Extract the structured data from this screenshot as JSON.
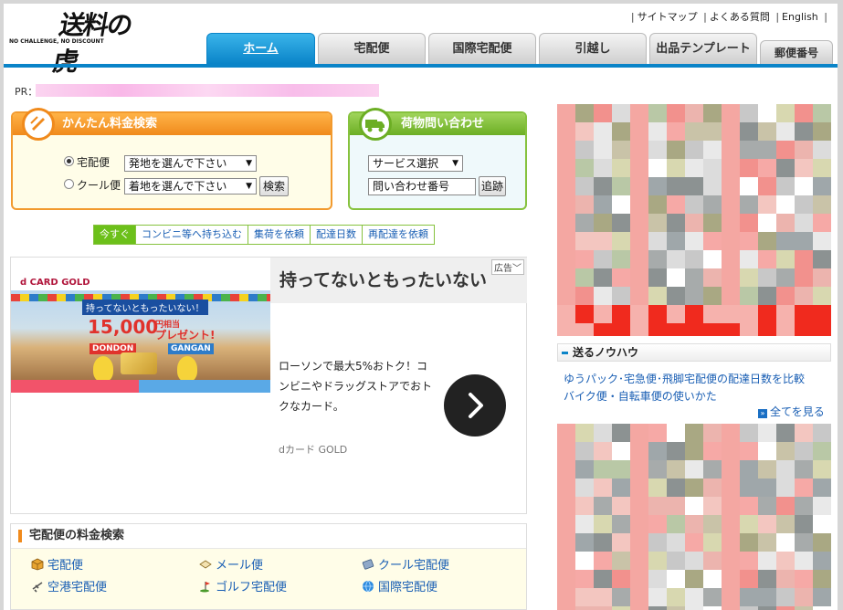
{
  "header": {
    "logo_text": "送料の虎",
    "logo_tagline": "NO CHALLENGE, NO DISCOUNT",
    "top_links": [
      "サイトマップ",
      "よくある質問",
      "English"
    ]
  },
  "tabs": [
    "ホーム",
    "宅配便",
    "国際宅配便",
    "引越し",
    "出品テンプレート",
    "郵便番号"
  ],
  "pr": {
    "label": "PR："
  },
  "rate_search": {
    "title": "かんたん料金検索",
    "option1": "宅配便",
    "option2": "クール便",
    "origin_select": "発地を選んで下さい",
    "dest_select": "着地を選んで下さい",
    "search_button": "検索"
  },
  "tracking": {
    "title": "荷物問い合わせ",
    "service_select": "サービス選択",
    "number_placeholder": "問い合わせ番号",
    "track_button": "追跡"
  },
  "subtabs": [
    "今すぐ",
    "コンビニ等へ持ち込む",
    "集荷を依頼",
    "配達日数",
    "再配達を依頼"
  ],
  "ad": {
    "badge": "広告",
    "headline": "持ってないともったいない",
    "body": "ローソンで最大5%おトク！コンビニやドラッグストアでおトクなカード。",
    "brand": "dカード GOLD",
    "img_brand": "d CARD GOLD",
    "img_banner": "持ってないともったいない！",
    "img_amount": "15,000",
    "img_unit": "円相当",
    "img_present": "プレゼント!",
    "img_left": "DONDON",
    "img_right": "GANGAN"
  },
  "price_search": {
    "title": "宅配便の料金検索",
    "items": [
      "宅配便",
      "メール便",
      "クール宅配便",
      "空港宅配便",
      "ゴルフ宅配便",
      "国際宅配便"
    ]
  },
  "knowhow": {
    "title": "送るノウハウ",
    "links": [
      "ゆうパック･宅急便･飛脚宅配便の配達日数を比較",
      "バイク便・自転車便の使いかた"
    ],
    "see_all": "全てを見る"
  },
  "colors": {
    "accent_blue": "#0a84c8",
    "orange": "#f08a1c",
    "green": "#6cae24",
    "link": "#1a5fb4"
  }
}
